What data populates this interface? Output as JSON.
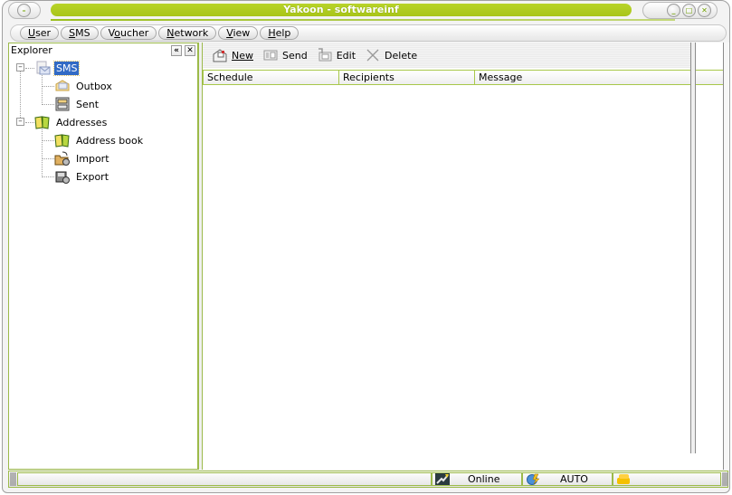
{
  "window": {
    "title": "Yakoon - softwareinf",
    "controls": {
      "system_icon": "system-menu-icon",
      "minimize_icon": "minimize-icon",
      "maximize_icon": "maximize-icon",
      "close_icon": "close-icon"
    }
  },
  "menu": [
    {
      "label": "User",
      "mnemonic": "U",
      "rest": "ser"
    },
    {
      "label": "SMS",
      "mnemonic": "S",
      "rest": "MS"
    },
    {
      "label": "Voucher",
      "pre": "V",
      "mnemonic": "o",
      "rest": "ucher"
    },
    {
      "label": "Network",
      "mnemonic": "N",
      "rest": "etwork"
    },
    {
      "label": "View",
      "mnemonic": "V",
      "rest": "iew"
    },
    {
      "label": "Help",
      "mnemonic": "H",
      "rest": "elp"
    }
  ],
  "explorer": {
    "title": "Explorer",
    "collapse_glyph": "«",
    "close_glyph": "✕",
    "tree": [
      {
        "label": "SMS",
        "icon": "sms-envelope-icon",
        "selected": true,
        "expanded": true,
        "children": [
          {
            "label": "Outbox",
            "icon": "outbox-icon"
          },
          {
            "label": "Sent",
            "icon": "sent-cabinet-icon"
          }
        ]
      },
      {
        "label": "Addresses",
        "icon": "address-book-icon",
        "selected": false,
        "expanded": true,
        "children": [
          {
            "label": "Address book",
            "icon": "address-book-icon"
          },
          {
            "label": "Import",
            "icon": "import-icon"
          },
          {
            "label": "Export",
            "icon": "export-icon"
          }
        ]
      }
    ]
  },
  "toolbar": {
    "new_label": "New",
    "send_label": "Send",
    "edit_label": "Edit",
    "delete_label": "Delete"
  },
  "table": {
    "columns": [
      "Schedule",
      "Recipients",
      "Message"
    ],
    "rows": []
  },
  "status": {
    "message": "",
    "connection": "Online",
    "mode": "AUTO"
  },
  "colors": {
    "accent": "#a8c418",
    "border": "#9cba4a",
    "selection": "#316ac5"
  }
}
